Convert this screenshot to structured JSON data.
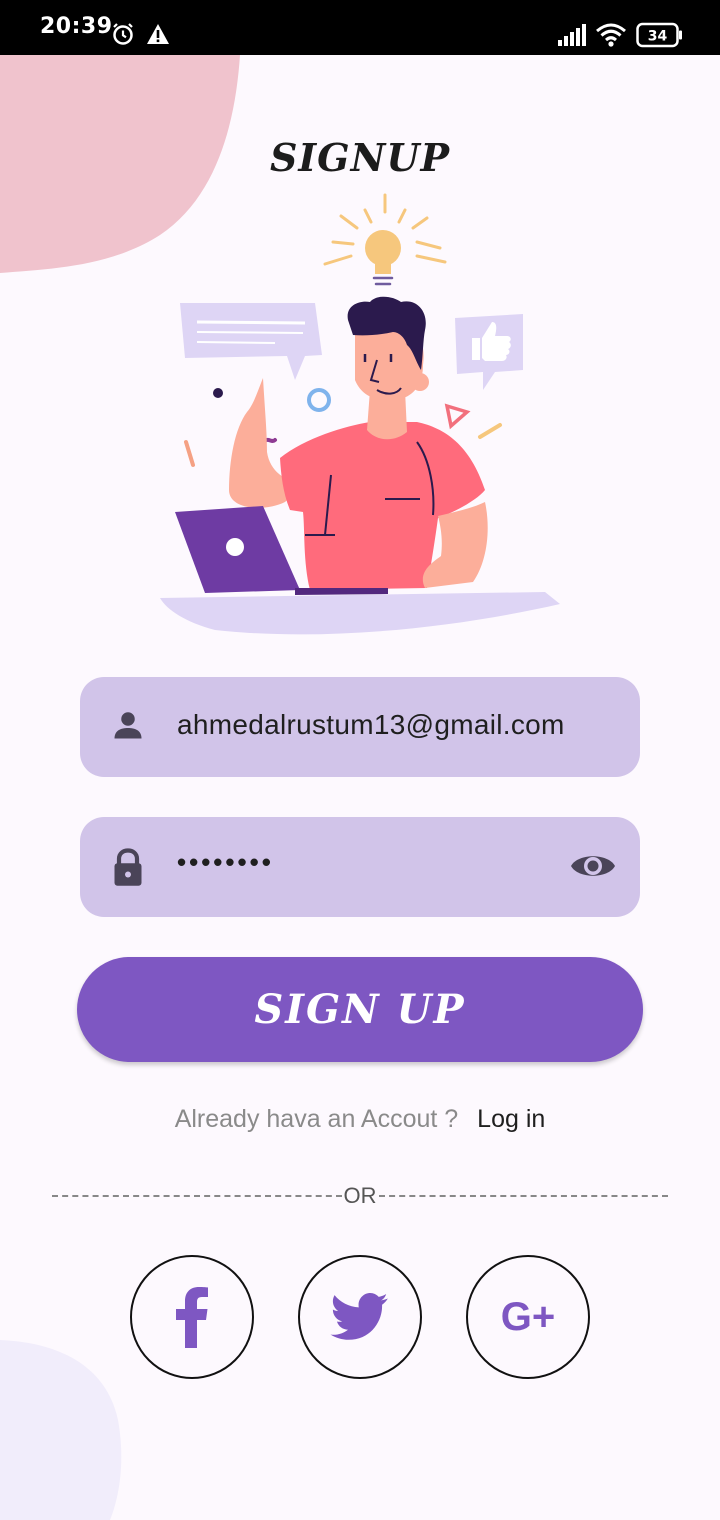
{
  "status_bar": {
    "time": "20:39",
    "battery": "34",
    "icons": [
      "alarm-icon",
      "warning-icon",
      "signal-icon",
      "wifi-icon",
      "battery-icon"
    ]
  },
  "header": {
    "title": "SIGNUP"
  },
  "form": {
    "email": {
      "icon": "person-icon",
      "value": "ahmedalrustum13@gmail.com"
    },
    "password": {
      "icon": "lock-icon",
      "value": "••••••••",
      "toggle_icon": "eye-icon"
    },
    "submit_label": "SIGN UP"
  },
  "login_prompt": {
    "question": "Already hava an Accout ?",
    "link": "Log in"
  },
  "divider": {
    "text": "OR"
  },
  "social": [
    {
      "name": "facebook",
      "icon": "facebook-icon"
    },
    {
      "name": "twitter",
      "icon": "twitter-icon"
    },
    {
      "name": "google",
      "icon": "google-plus-icon",
      "glyph": "G+"
    }
  ],
  "colors": {
    "accent": "#7e57c2",
    "field_bg": "#d1c4e9",
    "background": "#fdf9fe",
    "blob_pink": "#f0c3cd",
    "blob_lavender": "#f1edfb",
    "shirt": "#ff6b7c"
  }
}
